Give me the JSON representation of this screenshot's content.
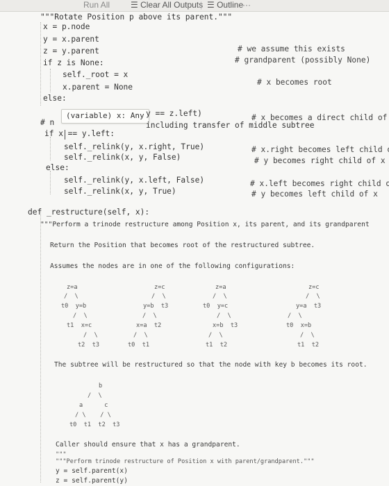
{
  "toolbar": {
    "partial_label": "Run All",
    "clear_outputs_label": "Clear All Outputs",
    "outline_label": "Outline",
    "more_label": "···"
  },
  "tooltip": {
    "text": "(variable) x: Any"
  },
  "code_lines": [
    "\"\"\"Rotate Position p above its parent.\"\"\"",
    "x = p.node",
    "y = x.parent",
    "z = y.parent",
    "if z is None:",
    "self._root = x",
    "x.parent = None",
    "else:",
    "y == z.left)",
    "including transfer of middle subtree",
    "# n",
    "if x == y.left:",
    "self._relink(y, x.right, True)",
    "self._relink(x, y, False)",
    "else:",
    "self._relink(y, x.left, False)",
    "self._relink(x, y, True)",
    "def _restructure(self, x):",
    "\"\"\"Perform a trinode restructure among Position x, its parent, and its grandparent",
    "Return the Position that becomes root of the restructured subtree.",
    "Assumes the nodes are in one of the following configurations:",
    "The subtree will be restructured so that the node with key b becomes its root.",
    "Caller should ensure that x has a grandparent.",
    "\"\"\"",
    "\"\"\"Perform trinode restructure of Position x with parent/grandparent.\"\"\"",
    "y = self.parent(x)",
    "z = self.parent(y)"
  ],
  "comments": [
    "# we assume this exists",
    "# grandparent (possibly None)",
    "# x becomes root",
    "# x becomes a direct child of z",
    "# x.right becomes left child of y",
    "# y becomes right child of x",
    "# x.left becomes right child of y",
    "# y becomes left child of x"
  ],
  "diagrams": {
    "config1": [
      "z=a",
      "/  \\",
      "t0  y=b",
      "/  \\",
      "t1  x=c",
      "/  \\",
      "t2  t3"
    ],
    "config2": [
      "z=c",
      "/  \\",
      "y=b  t3",
      "/  \\",
      "x=a  t2",
      "/  \\",
      "t0  t1"
    ],
    "config3": [
      "z=a",
      "/  \\",
      "t0  y=c",
      "/  \\",
      "x=b  t3",
      "/  \\",
      "t1  t2"
    ],
    "config4": [
      "z=c",
      "/  \\",
      "y=a  t3",
      "/  \\",
      "t0  x=b",
      "/  \\",
      "t1  t2"
    ],
    "result": [
      "b",
      "/  \\",
      "a      c",
      "/ \\    / \\",
      "t0  t1  t2  t3"
    ]
  }
}
